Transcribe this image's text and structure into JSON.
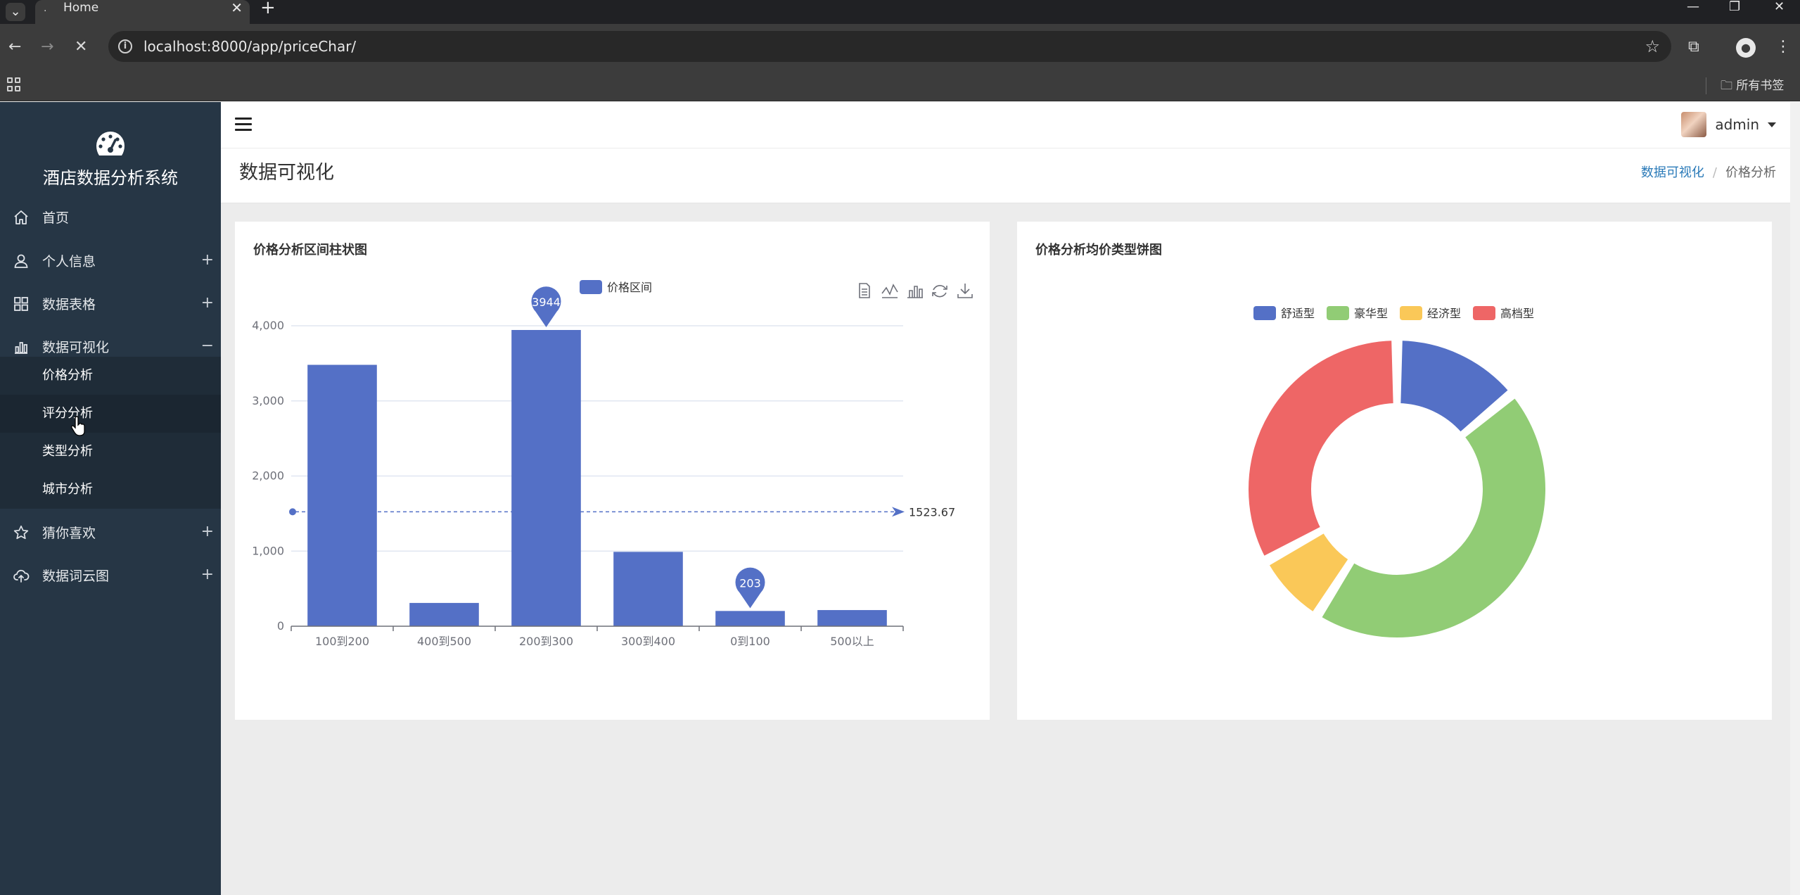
{
  "browser": {
    "tab_title": "Home",
    "url": "localhost:8000/app/priceChar/",
    "bookmarks_label": "所有书签"
  },
  "sidebar": {
    "app_title": "酒店数据分析系统",
    "items": [
      {
        "label": "首页",
        "icon": "home-icon",
        "toggle": ""
      },
      {
        "label": "个人信息",
        "icon": "user-icon",
        "toggle": "+"
      },
      {
        "label": "数据表格",
        "icon": "grid-icon",
        "toggle": "+"
      },
      {
        "label": "数据可视化",
        "icon": "bar-chart-icon",
        "toggle": "−"
      },
      {
        "label": "猜你喜欢",
        "icon": "star-icon",
        "toggle": "+"
      },
      {
        "label": "数据词云图",
        "icon": "cloud-upload-icon",
        "toggle": "+"
      }
    ],
    "sub_items": [
      {
        "label": "价格分析"
      },
      {
        "label": "评分分析"
      },
      {
        "label": "类型分析"
      },
      {
        "label": "城市分析"
      }
    ]
  },
  "header": {
    "user_name": "admin"
  },
  "page": {
    "title": "数据可视化",
    "breadcrumb": [
      "数据可视化",
      "价格分析"
    ]
  },
  "cards": {
    "bar_title": "价格分析区间柱状图",
    "pie_title": "价格分析均价类型饼图"
  },
  "chart_data": [
    {
      "type": "bar",
      "title": "价格分析区间柱状图",
      "legend": [
        "价格区间"
      ],
      "legend_position": "top-center",
      "categories": [
        "100到200",
        "400到500",
        "200到300",
        "300到400",
        "0到100",
        "500以上"
      ],
      "series": [
        {
          "name": "价格区间",
          "values": [
            3480,
            310,
            3944,
            990,
            203,
            215
          ]
        }
      ],
      "ylim": [
        0,
        4000
      ],
      "yticks": [
        0,
        1000,
        2000,
        3000,
        4000
      ],
      "ytick_labels": [
        "0",
        "1,000",
        "2,000",
        "3,000",
        "4,000"
      ],
      "mark_points": [
        {
          "label": "3944",
          "category": "200到300",
          "value": 3944
        },
        {
          "label": "203",
          "category": "0到100",
          "value": 203
        }
      ],
      "mark_line": {
        "type": "average",
        "value": 1523.67,
        "label": "1523.67"
      },
      "grid": true,
      "color": "#5470c6",
      "toolbox": [
        "data-view-icon",
        "line-chart-icon",
        "bar-chart-icon",
        "refresh-icon",
        "download-icon"
      ]
    },
    {
      "type": "pie",
      "title": "价格分析均价类型饼图",
      "donut": true,
      "legend_position": "top-center",
      "labels": [
        "舒适型",
        "豪华型",
        "经济型",
        "高档型"
      ],
      "values": [
        14,
        45,
        8,
        33
      ],
      "colors": [
        "#5470c6",
        "#91cc75",
        "#fac858",
        "#ee6666"
      ]
    }
  ]
}
